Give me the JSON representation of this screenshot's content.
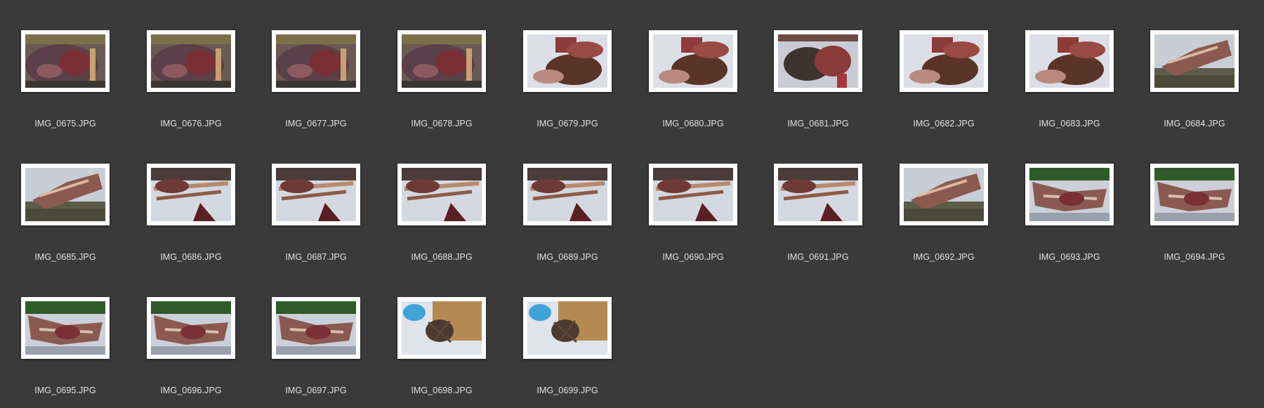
{
  "files": [
    {
      "name": "IMG_0675.JPG",
      "scene": "carcass-garden"
    },
    {
      "name": "IMG_0676.JPG",
      "scene": "carcass-garden"
    },
    {
      "name": "IMG_0677.JPG",
      "scene": "carcass-garden"
    },
    {
      "name": "IMG_0678.JPG",
      "scene": "carcass-garden"
    },
    {
      "name": "IMG_0679.JPG",
      "scene": "meat-table"
    },
    {
      "name": "IMG_0680.JPG",
      "scene": "meat-table"
    },
    {
      "name": "IMG_0681.JPG",
      "scene": "meat-table-dark"
    },
    {
      "name": "IMG_0682.JPG",
      "scene": "meat-table"
    },
    {
      "name": "IMG_0683.JPG",
      "scene": "meat-table"
    },
    {
      "name": "IMG_0684.JPG",
      "scene": "bones-pavement"
    },
    {
      "name": "IMG_0685.JPG",
      "scene": "bones-pavement"
    },
    {
      "name": "IMG_0686.JPG",
      "scene": "bones-table"
    },
    {
      "name": "IMG_0687.JPG",
      "scene": "bones-table"
    },
    {
      "name": "IMG_0688.JPG",
      "scene": "bones-table"
    },
    {
      "name": "IMG_0689.JPG",
      "scene": "bones-table"
    },
    {
      "name": "IMG_0690.JPG",
      "scene": "bones-table"
    },
    {
      "name": "IMG_0691.JPG",
      "scene": "bones-table"
    },
    {
      "name": "IMG_0692.JPG",
      "scene": "bones-pavement"
    },
    {
      "name": "IMG_0693.JPG",
      "scene": "carcass-hedge"
    },
    {
      "name": "IMG_0694.JPG",
      "scene": "carcass-hedge"
    },
    {
      "name": "IMG_0695.JPG",
      "scene": "carcass-hedge"
    },
    {
      "name": "IMG_0696.JPG",
      "scene": "carcass-hedge"
    },
    {
      "name": "IMG_0697.JPG",
      "scene": "carcass-hedge"
    },
    {
      "name": "IMG_0698.JPG",
      "scene": "gloves-board"
    },
    {
      "name": "IMG_0699.JPG",
      "scene": "gloves-board"
    }
  ],
  "colors": {
    "background": "#3a3a3a",
    "label_text": "#e0e0e0",
    "frame": "#ffffff"
  }
}
